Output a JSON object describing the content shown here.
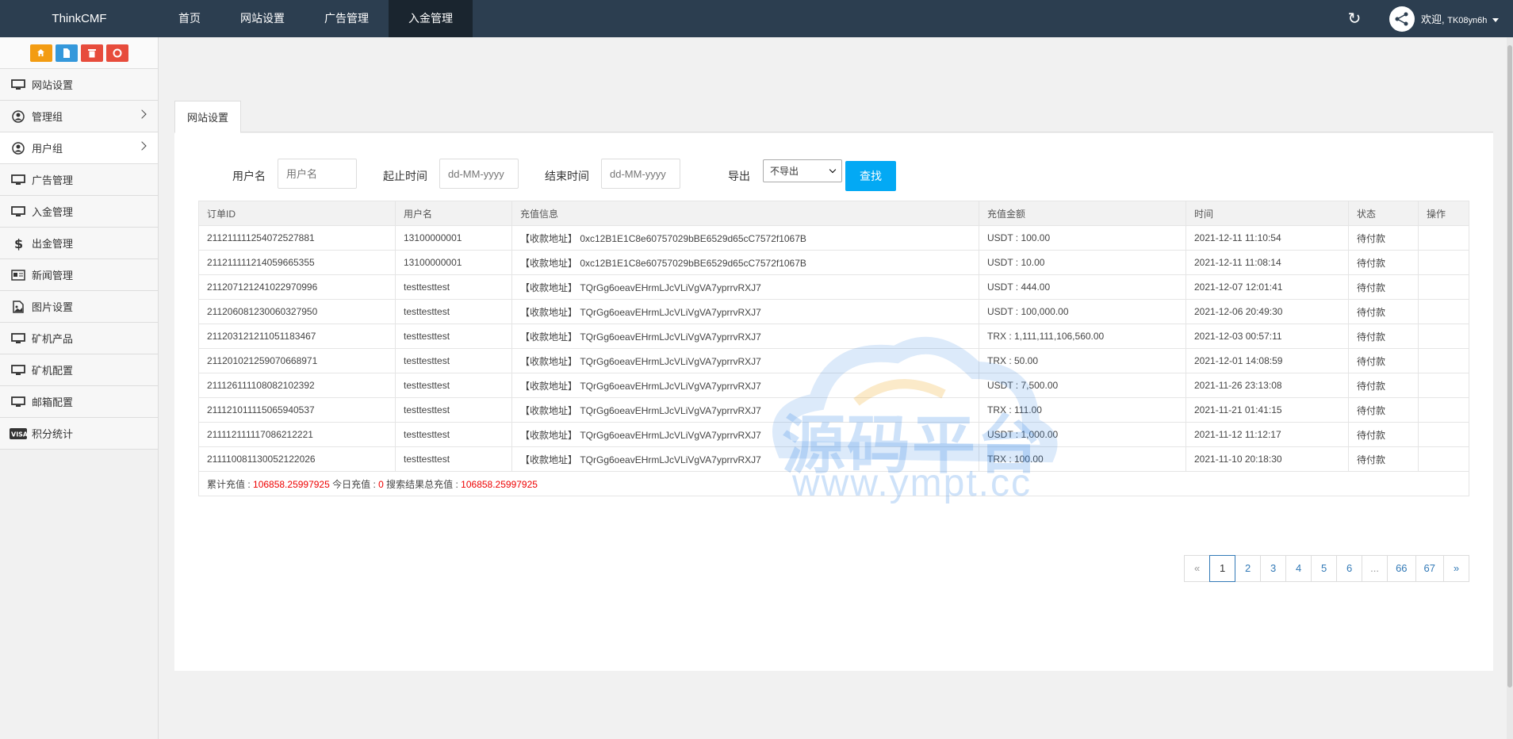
{
  "brand": "ThinkCMF",
  "top_nav": [
    {
      "label": "首页",
      "active": false
    },
    {
      "label": "网站设置",
      "active": false
    },
    {
      "label": "广告管理",
      "active": false
    },
    {
      "label": "入金管理",
      "active": true
    }
  ],
  "user": {
    "welcome": "欢迎,",
    "name": "TK08yn6h"
  },
  "sidebar": {
    "items": [
      {
        "label": "网站设置",
        "icon": "monitor-icon",
        "has_children": false,
        "active": false
      },
      {
        "label": "管理组",
        "icon": "user-circle-icon",
        "has_children": true,
        "active": false
      },
      {
        "label": "用户组",
        "icon": "user-circle-icon",
        "has_children": true,
        "active": true
      },
      {
        "label": "广告管理",
        "icon": "monitor-icon",
        "has_children": false,
        "active": false
      },
      {
        "label": "入金管理",
        "icon": "monitor-icon",
        "has_children": false,
        "active": false
      },
      {
        "label": "出金管理",
        "icon": "dollar-icon",
        "has_children": false,
        "active": false
      },
      {
        "label": "新闻管理",
        "icon": "newspaper-icon",
        "has_children": false,
        "active": false
      },
      {
        "label": "图片设置",
        "icon": "image-icon",
        "has_children": false,
        "active": false
      },
      {
        "label": "矿机产品",
        "icon": "monitor-icon",
        "has_children": false,
        "active": false
      },
      {
        "label": "矿机配置",
        "icon": "monitor-icon",
        "has_children": false,
        "active": false
      },
      {
        "label": "邮箱配置",
        "icon": "monitor-icon",
        "has_children": false,
        "active": false
      },
      {
        "label": "积分统计",
        "icon": "visa-card-icon",
        "has_children": false,
        "active": false
      }
    ]
  },
  "tab": {
    "label": "网站设置"
  },
  "filters": {
    "username_label": "用户名",
    "username_placeholder": "用户名",
    "start_label": "起止时间",
    "start_placeholder": "dd-MM-yyyy",
    "end_label": "结束时间",
    "end_placeholder": "dd-MM-yyyy",
    "export_label": "导出",
    "export_value": "不导出",
    "search_button": "查找"
  },
  "table": {
    "columns": [
      "订单ID",
      "用户名",
      "充值信息",
      "充值金额",
      "时间",
      "状态",
      "操作"
    ],
    "rows": [
      {
        "id": "2112111112540725278​81",
        "user": "13100000001",
        "info": "【收款地址】 0xc12B1E1C8e60757029bBE6529d65cC7572f1067B",
        "amount": "USDT : 100.00",
        "time": "2021-12-11 11:10:54",
        "status": "待付款"
      },
      {
        "id": "211211111214059665355",
        "user": "13100000001",
        "info": "【收款地址】 0xc12B1E1C8e60757029bBE6529d65cC7572f1067B",
        "amount": "USDT : 10.00",
        "time": "2021-12-11 11:08:14",
        "status": "待付款"
      },
      {
        "id": "211207121241022970996",
        "user": "testtesttest",
        "info": "【收款地址】 TQrGg6oeavEHrmLJcVLiVgVA7yprrvRXJ7",
        "amount": "USDT : 444.00",
        "time": "2021-12-07 12:01:41",
        "status": "待付款"
      },
      {
        "id": "211206081230060327950",
        "user": "testtesttest",
        "info": "【收款地址】 TQrGg6oeavEHrmLJcVLiVgVA7yprrvRXJ7",
        "amount": "USDT : 100,000.00",
        "time": "2021-12-06 20:49:30",
        "status": "待付款"
      },
      {
        "id": "211203121211051183467",
        "user": "testtesttest",
        "info": "【收款地址】 TQrGg6oeavEHrmLJcVLiVgVA7yprrvRXJ7",
        "amount": "TRX : 1,111,111,106,560.00",
        "time": "2021-12-03 00:57:11",
        "status": "待付款"
      },
      {
        "id": "211201021259070668971",
        "user": "testtesttest",
        "info": "【收款地址】 TQrGg6oeavEHrmLJcVLiVgVA7yprrvRXJ7",
        "amount": "TRX : 50.00",
        "time": "2021-12-01 14:08:59",
        "status": "待付款"
      },
      {
        "id": "211126111108082102392",
        "user": "testtesttest",
        "info": "【收款地址】 TQrGg6oeavEHrmLJcVLiVgVA7yprrvRXJ7",
        "amount": "USDT : 7,500.00",
        "time": "2021-11-26 23:13:08",
        "status": "待付款"
      },
      {
        "id": "211121011115065940537",
        "user": "testtesttest",
        "info": "【收款地址】 TQrGg6oeavEHrmLJcVLiVgVA7yprrvRXJ7",
        "amount": "TRX : 111.00",
        "time": "2021-11-21 01:41:15",
        "status": "待付款"
      },
      {
        "id": "211112111117086212221",
        "user": "testtesttest",
        "info": "【收款地址】 TQrGg6oeavEHrmLJcVLiVgVA7yprrvRXJ7",
        "amount": "USDT : 1,000.00",
        "time": "2021-11-12 11:12:17",
        "status": "待付款"
      },
      {
        "id": "211110081130052122026",
        "user": "testtesttest",
        "info": "【收款地址】 TQrGg6oeavEHrmLJcVLiVgVA7yprrvRXJ7",
        "amount": "TRX : 100.00",
        "time": "2021-11-10 20:18:30",
        "status": "待付款"
      }
    ],
    "summary": {
      "total_label": "累计充值 : ",
      "total_value": "106858.25997925",
      "today_label": " 今日充值 : ",
      "today_value": "0",
      "search_label": " 搜索结果总充值 : ",
      "search_value": "106858.25997925"
    }
  },
  "pagination": [
    "«",
    "1",
    "2",
    "3",
    "4",
    "5",
    "6",
    "...",
    "66",
    "67",
    "»"
  ],
  "pagination_current": "1",
  "watermark": {
    "text": "源码平台",
    "url": "www.ympt.cc"
  },
  "colors": {
    "topbar": "#2c3e50",
    "accent": "#03a9f4",
    "highlight_red": "#ee0000"
  }
}
